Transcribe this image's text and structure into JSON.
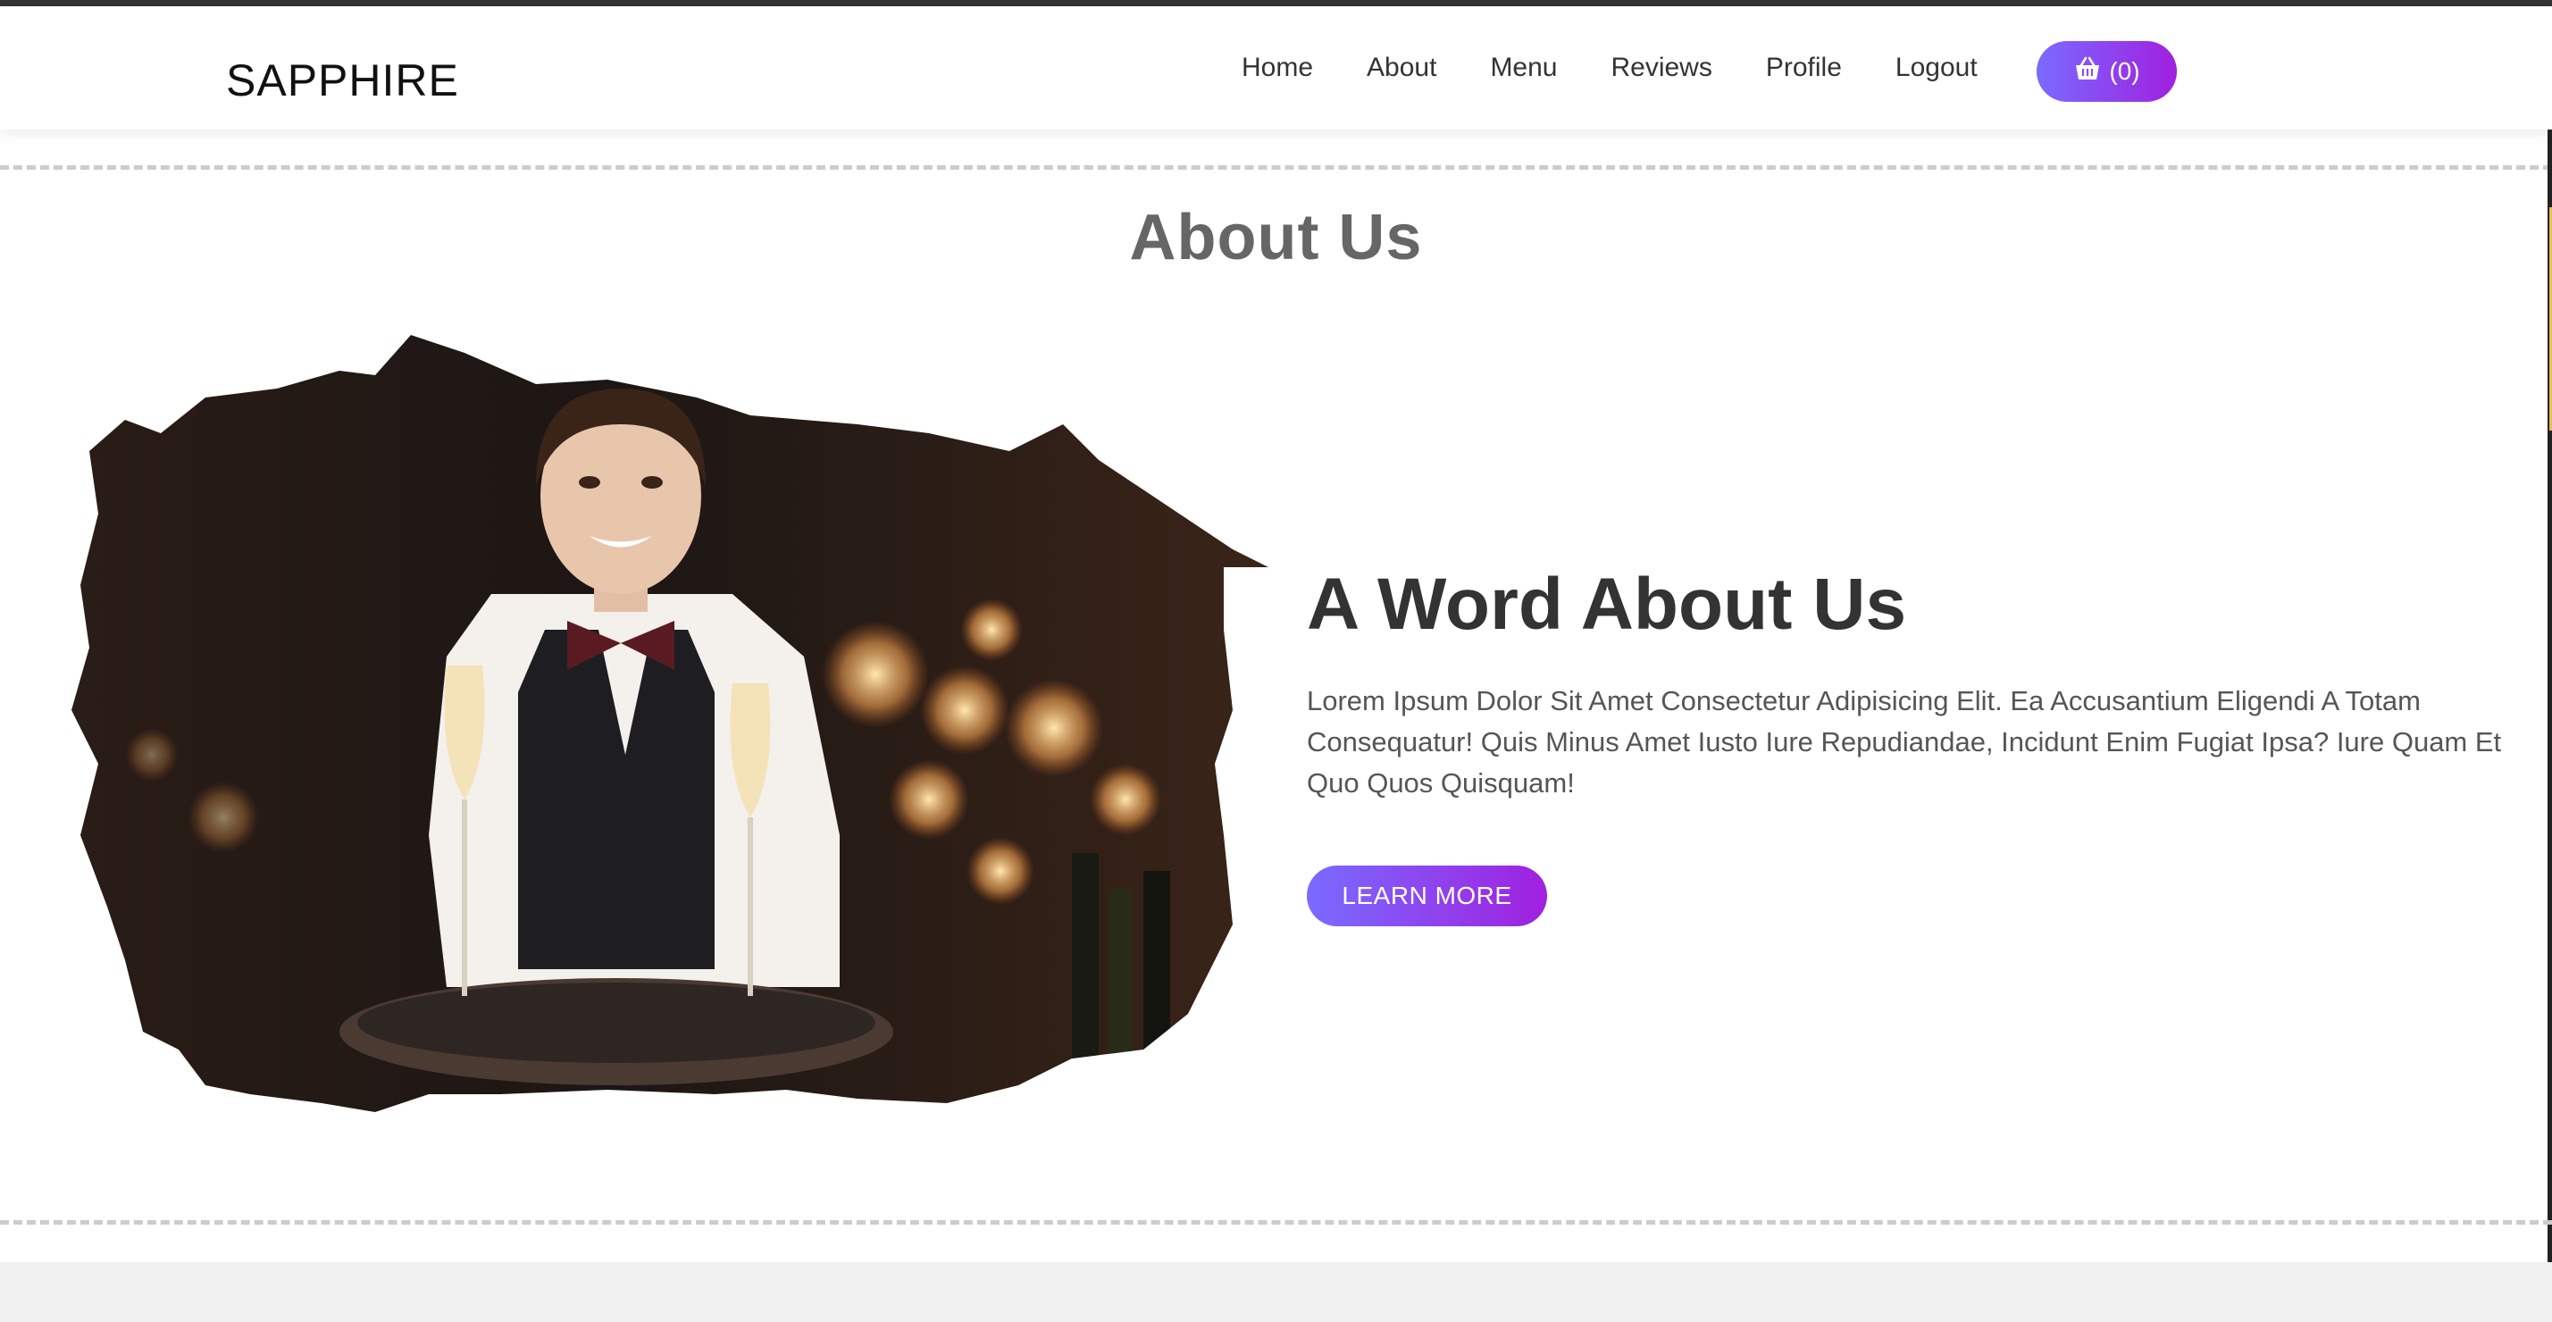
{
  "brand": {
    "logo": "SAPPHIRE"
  },
  "nav": {
    "links": [
      "Home",
      "About",
      "Menu",
      "Reviews",
      "Profile",
      "Logout"
    ],
    "cart_label": "(0)",
    "cart_icon": "shopping-basket-icon"
  },
  "about": {
    "section_title": "About Us",
    "heading": "A Word About Us",
    "paragraph": "Lorem Ipsum Dolor Sit Amet Consectetur Adipisicing Elit. Ea Accusantium Eligendi A Totam Consequatur! Quis Minus Amet Iusto Iure Repudiandae, Incidunt Enim Fugiat Ipsa? Iure Quam Et Quo Quos Quisquam!",
    "button_label": "LEARN MORE"
  },
  "colors": {
    "accent_start": "#7a6bff",
    "accent_end": "#a020e0",
    "heading": "#333333",
    "muted_text": "#555555"
  }
}
